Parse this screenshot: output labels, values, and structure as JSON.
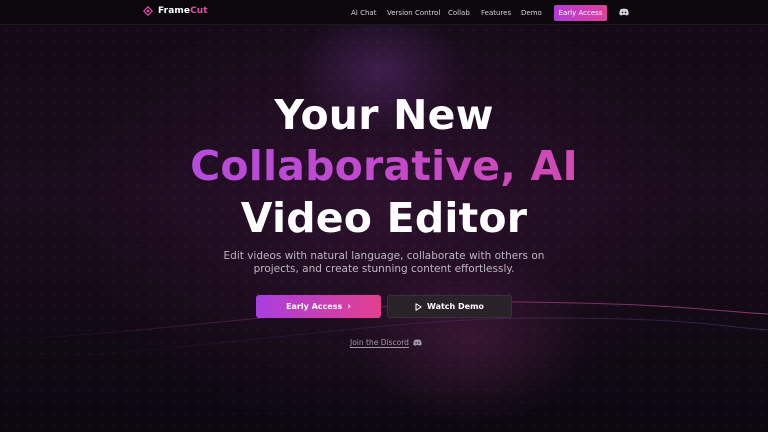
{
  "brand": {
    "name_part1": "Frame",
    "name_part2": "Cut",
    "icon": "diamond-logo-icon",
    "accent_color": "#e04fa5"
  },
  "nav": {
    "links": [
      "AI Chat",
      "Version Control",
      "Collab",
      "Features",
      "Demo"
    ],
    "cta_label": "Early Access",
    "discord_icon": "discord-icon"
  },
  "hero": {
    "title_line1": "Your New",
    "title_line2": "Collaborative, AI",
    "title_line3": "Video Editor",
    "subtitle_line1": "Edit videos with natural language, collaborate with others on",
    "subtitle_line2": "projects, and create stunning content effortlessly.",
    "primary_button": "Early Access",
    "primary_button_icon": "chevron-right-icon",
    "secondary_button": "Watch Demo",
    "secondary_button_icon": "play-icon",
    "discord_link": "Join the Discord",
    "discord_link_icon": "discord-icon"
  },
  "colors": {
    "gradient_start": "#a84ee6",
    "gradient_end": "#e0489a",
    "background": "#120a14"
  }
}
